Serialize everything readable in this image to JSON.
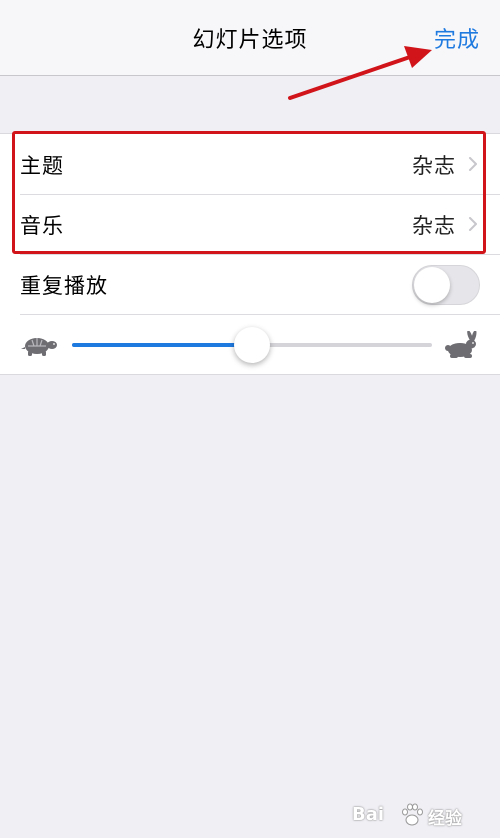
{
  "navbar": {
    "title": "幻灯片选项",
    "done_label": "完成"
  },
  "settings": {
    "theme": {
      "label": "主题",
      "value": "杂志"
    },
    "music": {
      "label": "音乐",
      "value": "杂志"
    },
    "repeat": {
      "label": "重复播放",
      "enabled": false
    },
    "speed": {
      "level": 0.5,
      "slow_icon": "turtle-icon",
      "fast_icon": "rabbit-icon"
    }
  },
  "annotations": {
    "highlight_color": "#d0141a",
    "arrow_color": "#d0141a"
  },
  "watermark": {
    "left": "Bai",
    "right": "经验"
  },
  "colors": {
    "accent": "#1f7ae0",
    "background": "#efeff4"
  }
}
